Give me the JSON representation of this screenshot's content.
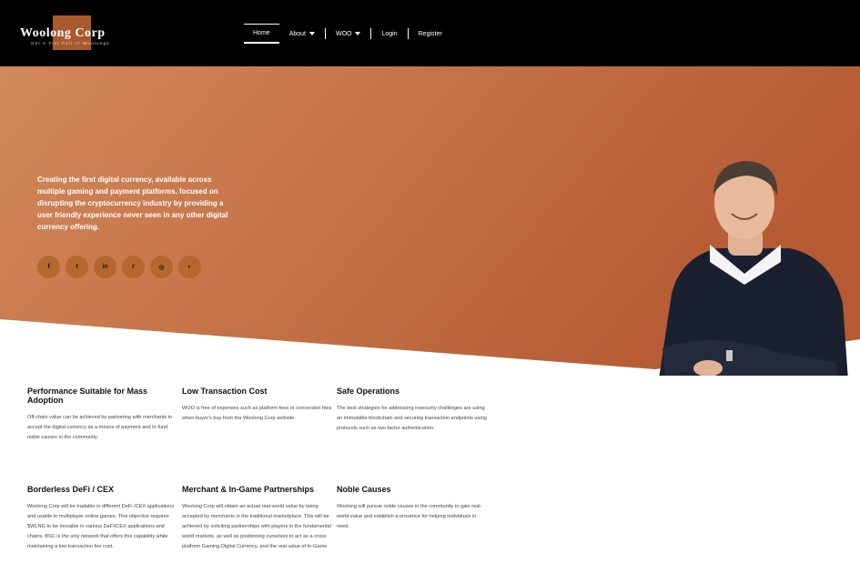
{
  "header": {
    "logo_text": "Woolong Corp",
    "logo_tagline": "Get A Fist Full of Woolongs",
    "nav": [
      {
        "label": "Home",
        "dropdown": false
      },
      {
        "label": "About",
        "dropdown": true
      },
      {
        "label": "WOO",
        "dropdown": true
      },
      {
        "label": "Login",
        "dropdown": false
      },
      {
        "label": "Register",
        "dropdown": false
      }
    ]
  },
  "hero": {
    "text": "Creating the first digital currency, available across multiple gaming and payment platforms, focused on disrupting the cryptocurrency industry by providing a user friendly experience never seen in any other digital currency offering.",
    "socials": [
      {
        "icon": "facebook-icon",
        "glyph": "f"
      },
      {
        "icon": "twitter-icon",
        "glyph": "t"
      },
      {
        "icon": "linkedin-icon",
        "glyph": "in"
      },
      {
        "icon": "reddit-icon",
        "glyph": "r"
      },
      {
        "icon": "instagram-icon",
        "glyph": "◎"
      },
      {
        "icon": "github-icon",
        "glyph": "◐"
      }
    ],
    "gradient_start": "#d2895a",
    "gradient_end": "#b65a33"
  },
  "features": [
    {
      "title": "Performance Suitable for Mass Adoption",
      "text": "Off-chain value can be achieved by partnering with merchants to accept the digital currency as a means of payment and to fund noble causes in the community."
    },
    {
      "title": "Low Transaction Cost",
      "text": "WOO is free of expenses such as platform fees or conversion fees when buyer's buy from the Woolong Corp website."
    },
    {
      "title": "Safe Operations",
      "text": "The best strategies for addressing insecurity challenges are using an immutable blockchain and securing transaction endpoints using protocols such as two-factor authentication."
    },
    {
      "title": "Borderless DeFi / CEX",
      "text": "Woolong Corp will be tradable in different DeFi /CEX applications and usable in multiplayer online games. This objective requires $WLNG to be movable in various DeFI/CEX applications and chains. BSC is the only network that offers this capability while maintaining a low transaction fee cost."
    },
    {
      "title": "Merchant & In-Game Partnerships",
      "text": "Woolong Corp  will obtain an actual real-world value by being accepted by merchants in the traditional marketplace. This will be achieved by soliciting partnerships with players in the fundamental world markets, as well as positioning ourselves to act as a cross platform Gaming Digital Currency, and the real value of In-Game"
    },
    {
      "title": "Noble Causes",
      "text": "Woolong will pursue noble causes in the community to gain real-world value and establish a presence for helping individuals in need."
    }
  ]
}
